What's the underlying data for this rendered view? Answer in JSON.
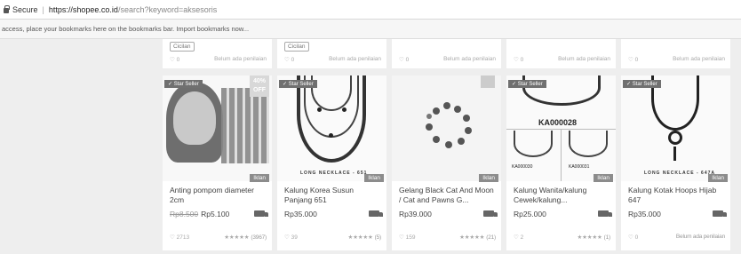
{
  "browser": {
    "secure_label": "Secure",
    "url_host": "https://shopee.co.id",
    "url_path": "/search?keyword=aksesoris",
    "bookmarks_hint": "access, place your bookmarks here on the bookmarks bar. Import bookmarks now..."
  },
  "top_row": [
    {
      "badge": "Cicilan",
      "likes": "♡ 0",
      "reviews": "Belum ada penilaian"
    },
    {
      "badge": "Cicilan",
      "likes": "♡ 0",
      "reviews": "Belum ada penilaian"
    },
    {
      "badge": "",
      "likes": "♡ 0",
      "reviews": "Belum ada penilaian"
    },
    {
      "badge": "",
      "likes": "♡ 0",
      "reviews": "Belum ada penilaian"
    },
    {
      "badge": "",
      "likes": "♡ 0",
      "reviews": "Belum ada penilaian"
    }
  ],
  "products": [
    {
      "star": "✓ Star Seller",
      "discount_pct": "40%",
      "discount_off": "OFF",
      "ad": "Iklan",
      "title": "Anting pompom diameter 2cm",
      "old_price": "Rp8.500",
      "price": "Rp5.100",
      "likes": "♡ 2713",
      "stars": "★★★★★",
      "review_count": "(3967)"
    },
    {
      "star": "✓ Star Seller",
      "ad": "Iklan",
      "watermark": "LONG NECKLACE - 651",
      "title": "Kalung Korea Susun Panjang 651",
      "old_price": "",
      "price": "Rp35.000",
      "likes": "♡ 39",
      "stars": "★★★★★",
      "review_count": "(5)"
    },
    {
      "star": "",
      "ad": "Iklan",
      "title": "Gelang Black Cat And Moon / Cat and Pawns G...",
      "old_price": "",
      "price": "Rp39.000",
      "likes": "♡ 159",
      "stars": "★★★★★",
      "review_count": "(21)"
    },
    {
      "star": "✓ Star Seller",
      "ad": "Iklan",
      "code_main": "KA000028",
      "code_left": "KA000030",
      "code_right": "KA000031",
      "title": "Kalung Wanita/kalung Cewek/kalung...",
      "old_price": "",
      "price": "Rp25.000",
      "likes": "♡ 2",
      "stars": "★★★★★",
      "review_count": "(1)"
    },
    {
      "star": "✓ Star Seller",
      "ad": "Iklan",
      "watermark": "LONG NECKLACE - 647A",
      "title": "Kalung Kotak Hoops Hijab 647",
      "old_price": "",
      "price": "Rp35.000",
      "likes": "♡ 0",
      "stars": "",
      "review_count": "Belum ada penilaian"
    }
  ],
  "colors": {
    "page_bg": "#eeeeee",
    "card_bg": "#ffffff",
    "badge_bg": "#707070"
  }
}
